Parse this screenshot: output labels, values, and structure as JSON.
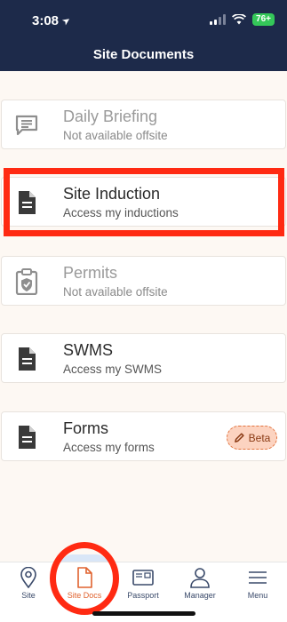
{
  "status": {
    "time": "3:08",
    "battery": "76+"
  },
  "header": {
    "title": "Site Documents"
  },
  "cards": [
    {
      "title": "Daily Briefing",
      "subtitle": "Not available offsite",
      "icon": "chat-lines-icon",
      "enabled": false
    },
    {
      "title": "Site Induction",
      "subtitle": "Access my inductions",
      "icon": "document-icon",
      "enabled": true
    },
    {
      "title": "Permits",
      "subtitle": "Not available offsite",
      "icon": "clipboard-shield-icon",
      "enabled": false
    },
    {
      "title": "SWMS",
      "subtitle": "Access my SWMS",
      "icon": "document-icon",
      "enabled": true
    },
    {
      "title": "Forms",
      "subtitle": "Access my forms",
      "icon": "document-icon",
      "enabled": true,
      "badge": "Beta"
    }
  ],
  "tabs": [
    {
      "label": "Site",
      "icon": "location-pin-icon"
    },
    {
      "label": "Site Docs",
      "icon": "document-icon",
      "active": true
    },
    {
      "label": "Passport",
      "icon": "passport-icon"
    },
    {
      "label": "Manager",
      "icon": "person-icon"
    },
    {
      "label": "Menu",
      "icon": "hamburger-icon"
    }
  ],
  "colors": {
    "header_bg": "#1d2a4a",
    "accent": "#e0622e",
    "annotation": "#ff2a12",
    "page_bg": "#fdf8f3"
  }
}
